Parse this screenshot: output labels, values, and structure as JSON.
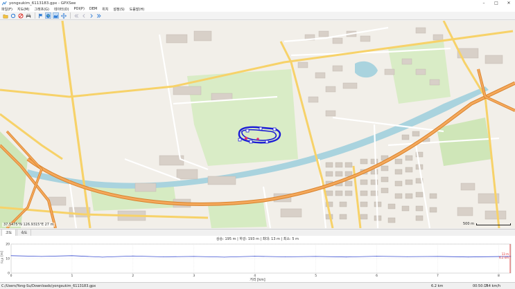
{
  "window": {
    "title": "yongsukim_6113183.gpx - GPXSee",
    "minimize": "–",
    "maximize": "□",
    "close": "✕"
  },
  "menu": [
    "파일(F)",
    "지도(M)",
    "그래프(G)",
    "데이터(D)",
    "POI(P)",
    "DEM",
    "위치",
    "설정(S)",
    "도움말(H)"
  ],
  "toolbar": {
    "buttons": [
      "open-file-icon",
      "reload-icon",
      "close-file-icon",
      "print-icon",
      "flag-icon",
      "show-map-icon",
      "show-graphs-icon",
      "fullscreen-icon",
      "first-icon",
      "previous-icon",
      "next-icon",
      "last-icon"
    ]
  },
  "map": {
    "coord_readout": "37.5475°N 126.9315°E 27 m",
    "scale_label": "500 m"
  },
  "tabs": [
    "고도",
    "속도"
  ],
  "profile": {
    "stats": "상승: 195 m | 하강: 193 m | 최대: 13 m | 최소: 5 m",
    "ylabel": "고도 [m]",
    "xlabel": "거리 [km]",
    "marker_top": "13 m",
    "marker_bottom": "6.2 km"
  },
  "chart_data": {
    "type": "line",
    "title": "",
    "xlabel": "거리 [km]",
    "ylabel": "고도 [m]",
    "xlim": [
      0,
      8.2
    ],
    "ylim": [
      0,
      20
    ],
    "xticks": [
      "0",
      "1",
      "2",
      "3",
      "4",
      "5",
      "6",
      "7",
      "8"
    ],
    "yticks": [
      "0",
      "10",
      "20"
    ],
    "series": [
      {
        "x": [
          0,
          0.5,
          1,
          1.5,
          2,
          2.5,
          3,
          3.5,
          4,
          4.5,
          5,
          5.5,
          6,
          6.5,
          7,
          7.5,
          8,
          8.2
        ],
        "values": [
          12,
          11.5,
          12,
          11,
          11.8,
          11.2,
          11.5,
          11,
          11.6,
          11.2,
          11.5,
          11.1,
          11.6,
          11.3,
          11.5,
          11.1,
          11.4,
          11.5
        ]
      }
    ]
  },
  "statusbar": {
    "path": "C:/Users/Yong-Su/Downloads/yongsukim_6113183.gpx",
    "distance": "6.2 km",
    "time": "00:50:14",
    "speed": "7.4 km/h"
  }
}
